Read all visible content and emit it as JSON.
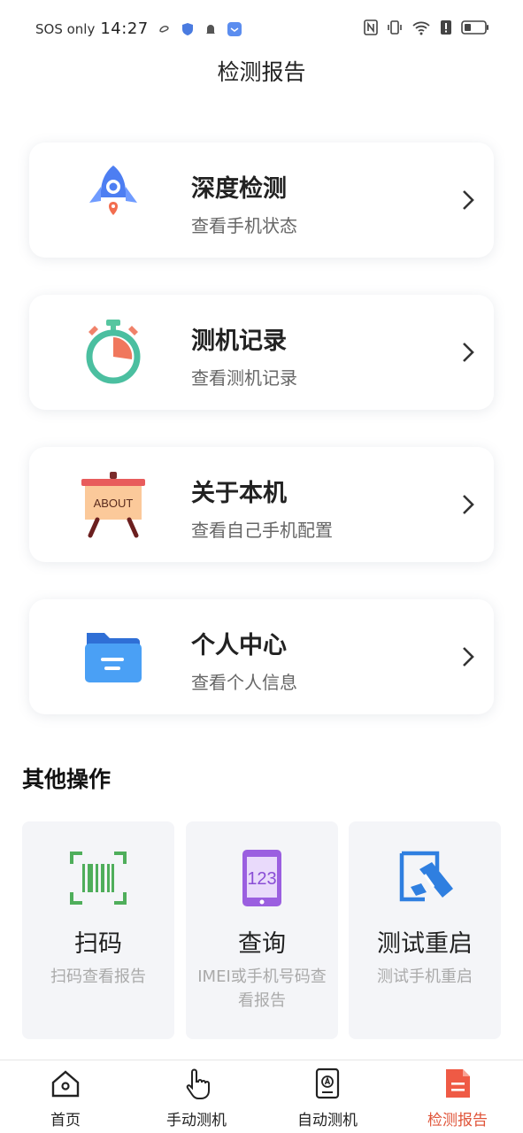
{
  "status_bar": {
    "carrier": "SOS only",
    "time": "14:27",
    "icons": [
      "weibo-icon",
      "shield-icon",
      "bell-icon",
      "app-badge-icon",
      "nfc-icon",
      "vibrate-icon",
      "wifi-icon",
      "alert-icon",
      "battery-icon"
    ]
  },
  "page_title": "检测报告",
  "cards": [
    {
      "title": "深度检测",
      "subtitle": "查看手机状态",
      "icon": "rocket-icon"
    },
    {
      "title": "测机记录",
      "subtitle": "查看测机记录",
      "icon": "stopwatch-icon"
    },
    {
      "title": "关于本机",
      "subtitle": "查看自己手机配置",
      "icon": "about-easel-icon",
      "icon_text": "ABOUT"
    },
    {
      "title": "个人中心",
      "subtitle": "查看个人信息",
      "icon": "folder-icon"
    }
  ],
  "other_section": {
    "title": "其他操作",
    "tiles": [
      {
        "title": "扫码",
        "subtitle": "扫码查看报告",
        "icon": "barcode-scan-icon"
      },
      {
        "title": "查询",
        "subtitle": "IMEI或手机号码查看报告",
        "icon": "phone-123-icon",
        "icon_text": "123"
      },
      {
        "title": "测试重启",
        "subtitle": "测试手机重启",
        "icon": "restart-test-icon"
      }
    ]
  },
  "bottom_nav": {
    "items": [
      {
        "label": "首页",
        "icon": "home-icon"
      },
      {
        "label": "手动测机",
        "icon": "hand-tap-icon"
      },
      {
        "label": "自动测机",
        "icon": "auto-phone-icon"
      },
      {
        "label": "检测报告",
        "icon": "report-icon"
      }
    ],
    "active_index": 3
  },
  "colors": {
    "active_tab": "#e0553a",
    "card_bg": "#ffffff",
    "tile_bg": "#f4f5f8"
  }
}
